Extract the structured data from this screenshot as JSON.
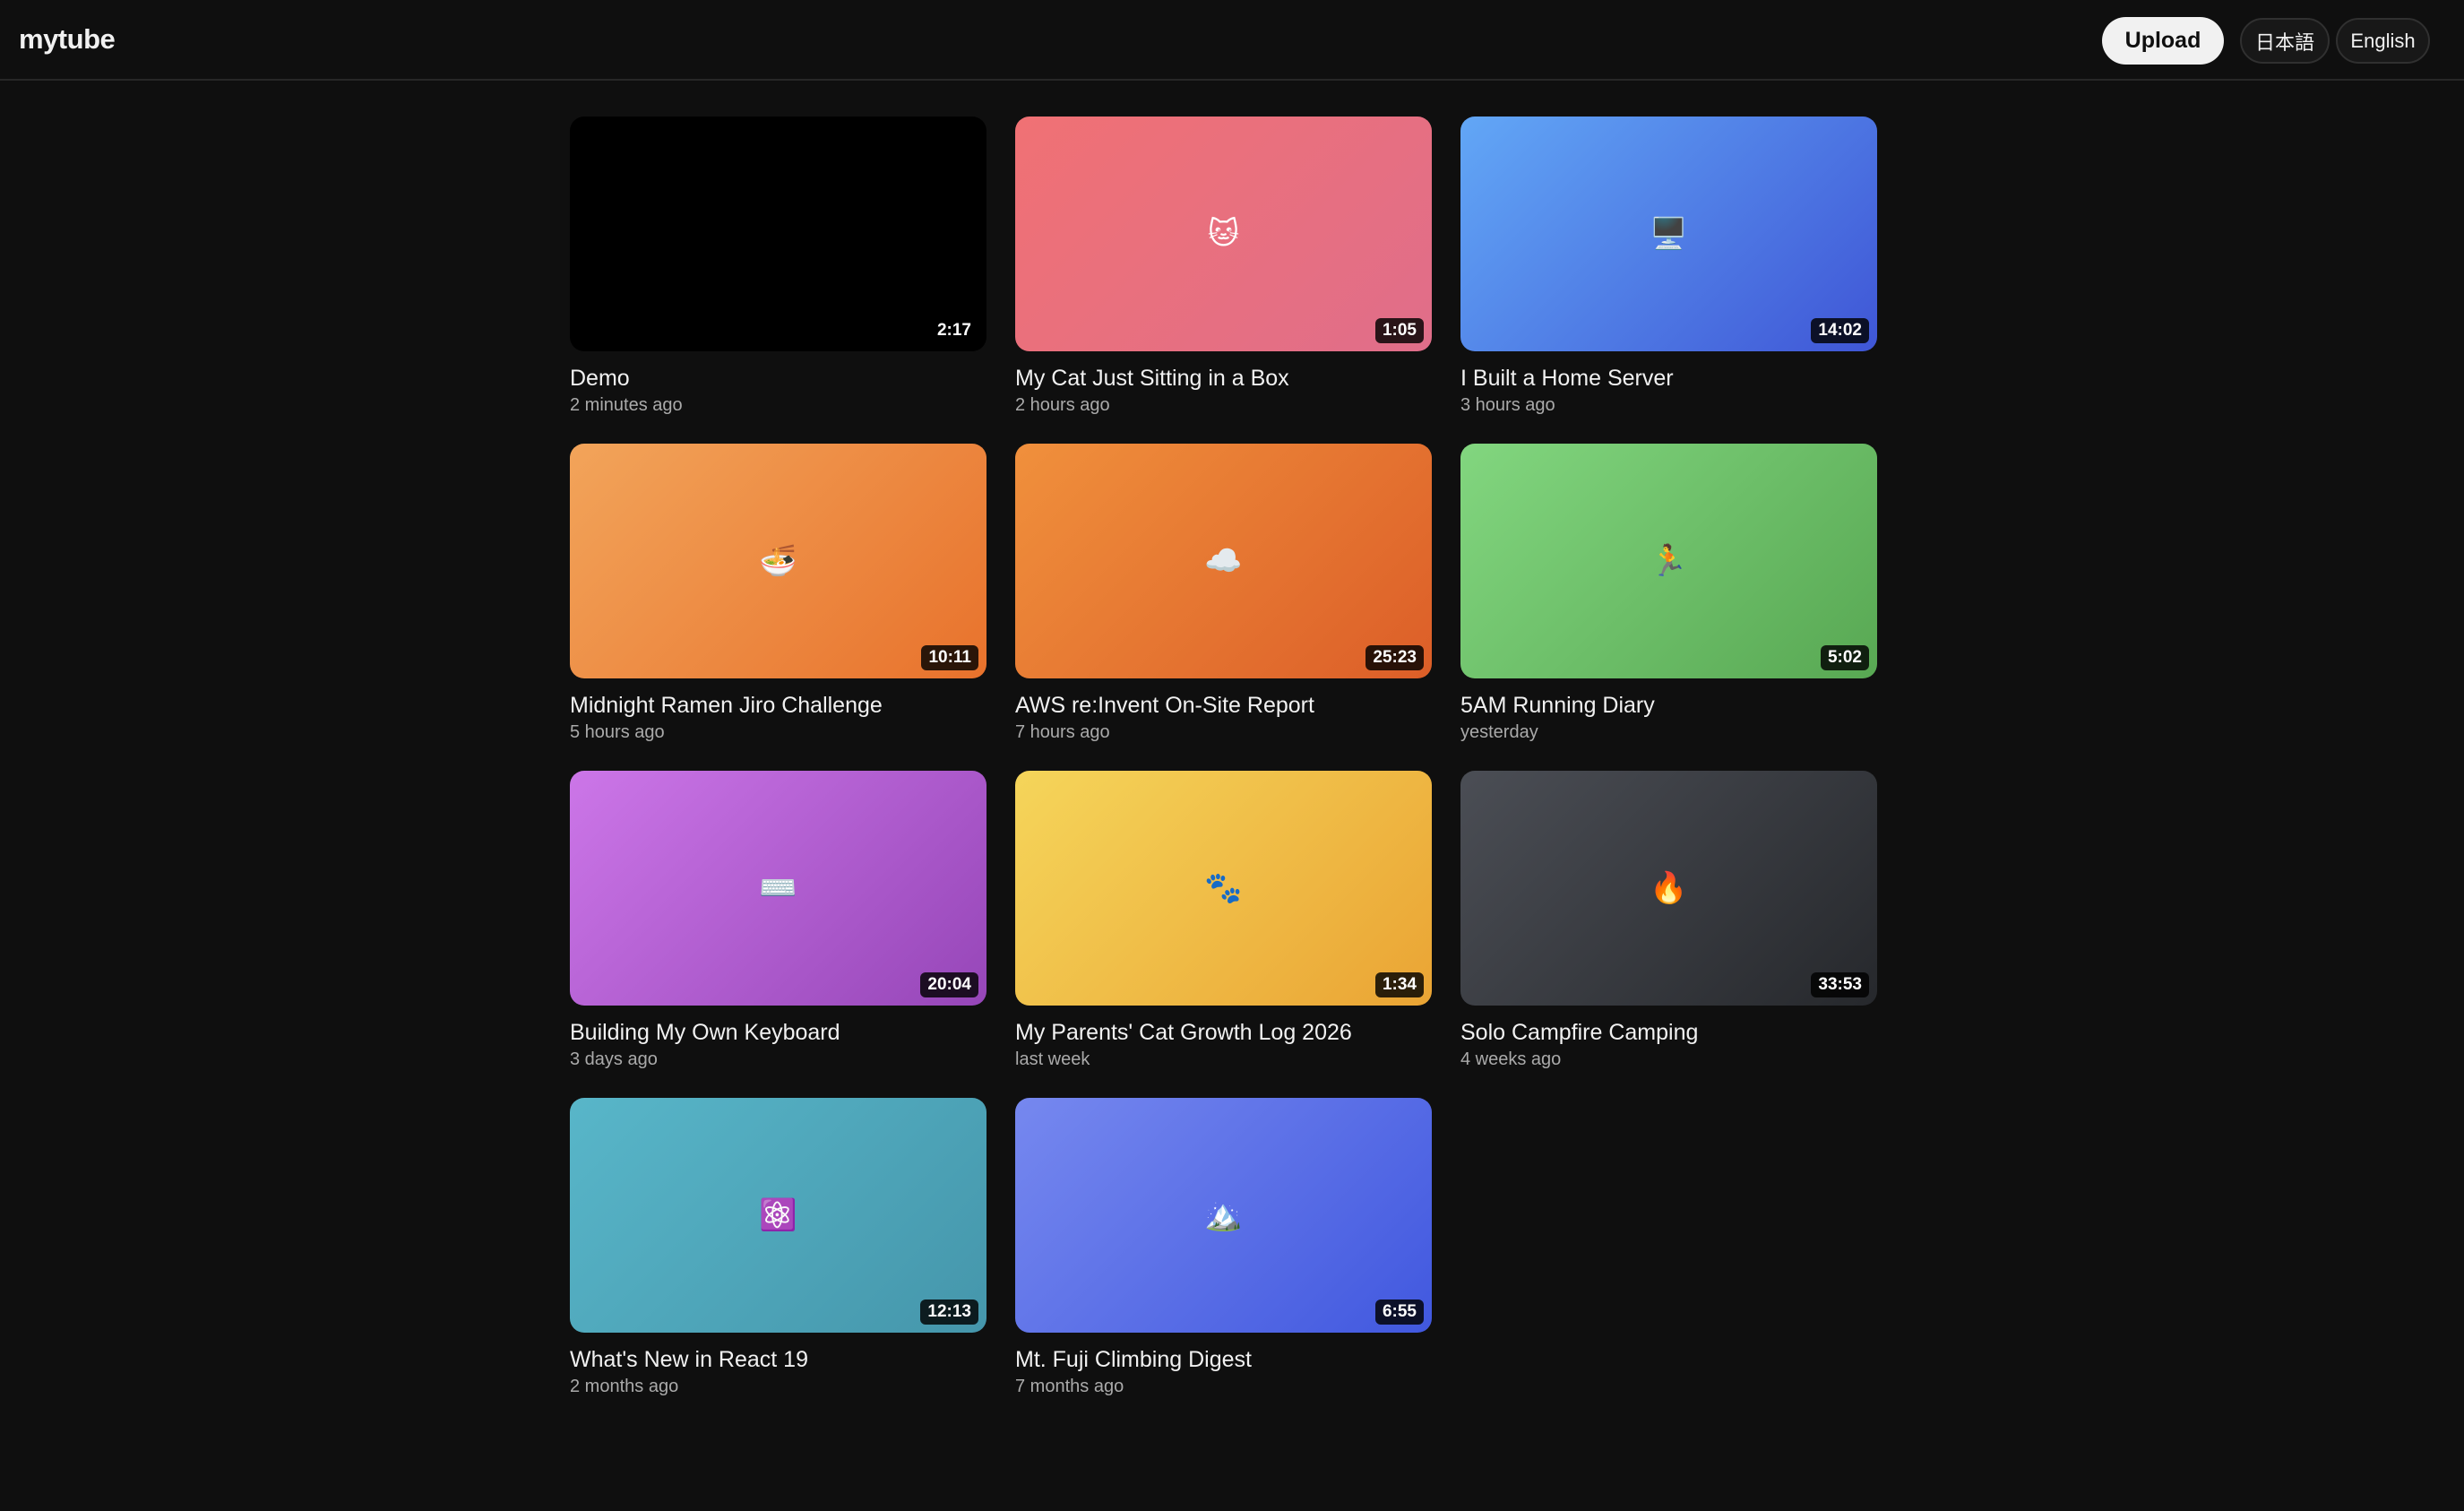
{
  "header": {
    "logo": "mytube",
    "upload_label": "Upload",
    "lang_ja_label": "日本語",
    "lang_en_label": "English"
  },
  "videos": [
    {
      "title": "Demo",
      "time": "2 minutes ago",
      "duration": "2:17",
      "icon": "",
      "icon_name": "blank-thumbnail",
      "bg": [
        "#000000",
        "#000000"
      ]
    },
    {
      "title": "My Cat Just Sitting in a Box",
      "time": "2 hours ago",
      "duration": "1:05",
      "icon": "🐱",
      "icon_name": "cat-face-icon",
      "bg": [
        "#f07174",
        "#e06e8a"
      ]
    },
    {
      "title": "I Built a Home Server",
      "time": "3 hours ago",
      "duration": "14:02",
      "icon": "🖥️",
      "icon_name": "desktop-computer-icon",
      "bg": [
        "#62a7f6",
        "#3f56d6"
      ]
    },
    {
      "title": "Midnight Ramen Jiro Challenge",
      "time": "5 hours ago",
      "duration": "10:11",
      "icon": "🍜",
      "icon_name": "ramen-bowl-icon",
      "bg": [
        "#f2a45a",
        "#e8722c"
      ]
    },
    {
      "title": "AWS re:Invent On-Site Report",
      "time": "7 hours ago",
      "duration": "25:23",
      "icon": "☁️",
      "icon_name": "cloud-icon",
      "bg": [
        "#f0903c",
        "#dc5e28"
      ]
    },
    {
      "title": "5AM Running Diary",
      "time": "yesterday",
      "duration": "5:02",
      "icon": "🏃",
      "icon_name": "runner-icon",
      "bg": [
        "#82d67f",
        "#58a853"
      ]
    },
    {
      "title": "Building My Own Keyboard",
      "time": "3 days ago",
      "duration": "20:04",
      "icon": "⌨️",
      "icon_name": "keyboard-icon",
      "bg": [
        "#cc76e8",
        "#9646b8"
      ]
    },
    {
      "title": "My Parents' Cat Growth Log 2026",
      "time": "last week",
      "duration": "1:34",
      "icon": "🐾",
      "icon_name": "paw-prints-icon",
      "bg": [
        "#f5d55a",
        "#eaa434"
      ]
    },
    {
      "title": "Solo Campfire Camping",
      "time": "4 weeks ago",
      "duration": "33:53",
      "icon": "🔥",
      "icon_name": "fire-icon",
      "bg": [
        "#4b4e55",
        "#26282c"
      ]
    },
    {
      "title": "What's New in React 19",
      "time": "2 months ago",
      "duration": "12:13",
      "icon": "⚛️",
      "icon_name": "atom-icon",
      "bg": [
        "#58b6c9",
        "#4596ab"
      ]
    },
    {
      "title": "Mt. Fuji Climbing Digest",
      "time": "7 months ago",
      "duration": "6:55",
      "icon": "🏔️",
      "icon_name": "mountain-icon",
      "bg": [
        "#7688ef",
        "#4158df"
      ]
    }
  ]
}
